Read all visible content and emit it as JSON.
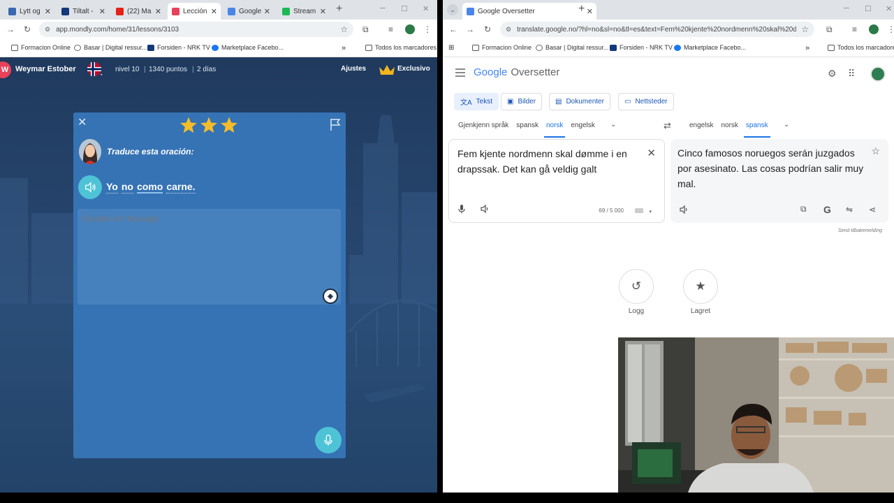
{
  "left_browser": {
    "tabs": [
      {
        "label": "Lytt og",
        "color": "#3a67b0"
      },
      {
        "label": "Tiltalt -",
        "color": "#14387a"
      },
      {
        "label": "(22) Ma",
        "color": "#e62117"
      },
      {
        "label": "Lección",
        "color": "#e8415a"
      },
      {
        "label": "Google",
        "color": "#4a86e8"
      },
      {
        "label": "Stream",
        "color": "#1db954"
      }
    ],
    "url": "app.mondly.com/home/31/lessons/3103",
    "bookmarks": [
      "Formacion Online",
      "Basar | Digital ressur...",
      "Forsiden - NRK TV",
      "Marketplace Facebo..."
    ],
    "all_bookmarks": "Todos los marcadores"
  },
  "mondly": {
    "avatar_initial": "W",
    "username": "Weymar Estober",
    "level": "nivel 10",
    "points": "1340 puntos",
    "streak": "2 días",
    "settings": "Ajustes",
    "exclusive": "Exclusivo",
    "stars": 3,
    "instruction": "Traduce esta oración:",
    "sentence": [
      "Yo",
      "no",
      "como",
      "carne."
    ],
    "placeholder": "Escribe en: Noruego"
  },
  "right_browser": {
    "tab_label": "Google Oversetter",
    "url": "translate.google.no/?hl=no&sl=no&tl=es&text=Fem%20kjente%20nordmenn%20skal%20d...",
    "bookmarks": [
      "Formacion Online",
      "Basar | Digital ressur...",
      "Forsiden - NRK TV",
      "Marketplace Facebo..."
    ],
    "all_bookmarks": "Todos los marcadores"
  },
  "translate": {
    "logo_google": "Google",
    "logo_product": "Oversetter",
    "modes": [
      "Tekst",
      "Bilder",
      "Dokumenter",
      "Nettsteder"
    ],
    "source_langs": [
      "Gjenkjenn språk",
      "spansk",
      "norsk",
      "engelsk"
    ],
    "target_langs": [
      "engelsk",
      "norsk",
      "spansk"
    ],
    "source_text": "Fem kjente nordmenn skal dømme i en drapssak.  Det kan gå veldig galt",
    "char_count": "69 / 5 000",
    "target_text": "Cinco famosos noruegos serán juzgados por asesinato. Las cosas podrían salir muy mal.",
    "feedback": "Send tilbakemelding",
    "history_label": "Logg",
    "saved_label": "Lagret"
  },
  "colors": {
    "mondly_card": "#3673b4",
    "mondly_accent": "#4ec3d6",
    "google_blue": "#1a73e8"
  }
}
